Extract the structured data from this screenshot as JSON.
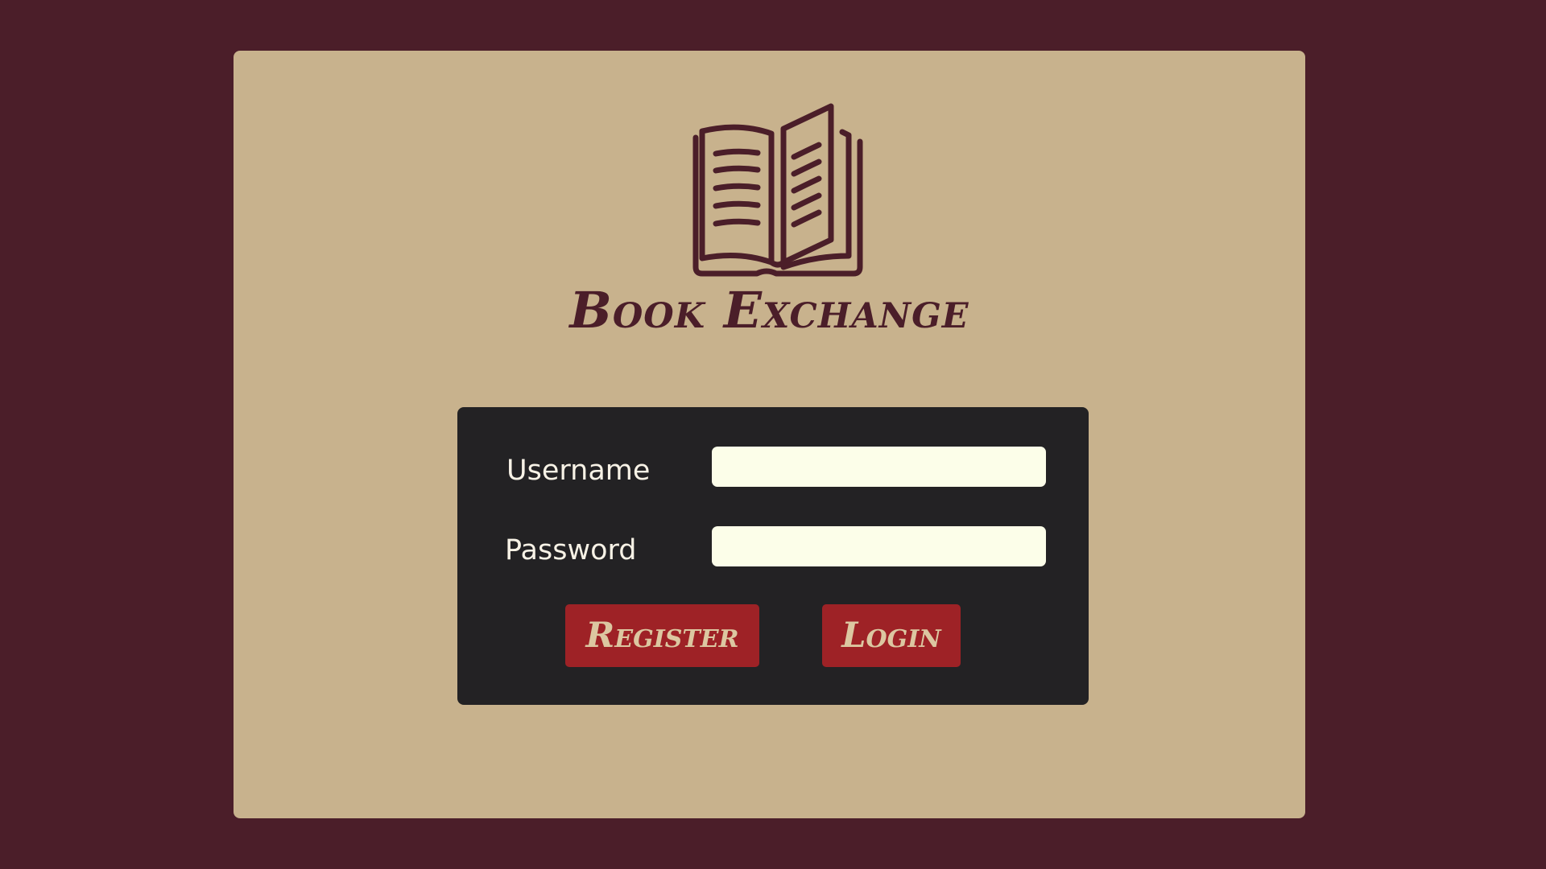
{
  "app": {
    "title": "Book Exchange",
    "logo_icon": "open-book-icon"
  },
  "login_form": {
    "username_label": "Username",
    "username_value": "",
    "password_label": "Password",
    "password_value": "",
    "register_label": "Register",
    "login_label": "Login"
  },
  "colors": {
    "background": "#4b1e29",
    "card": "#c8b28d",
    "panel": "#232224",
    "input": "#fcfee9",
    "button": "#9e2226",
    "button_text": "#dcc7a1"
  }
}
